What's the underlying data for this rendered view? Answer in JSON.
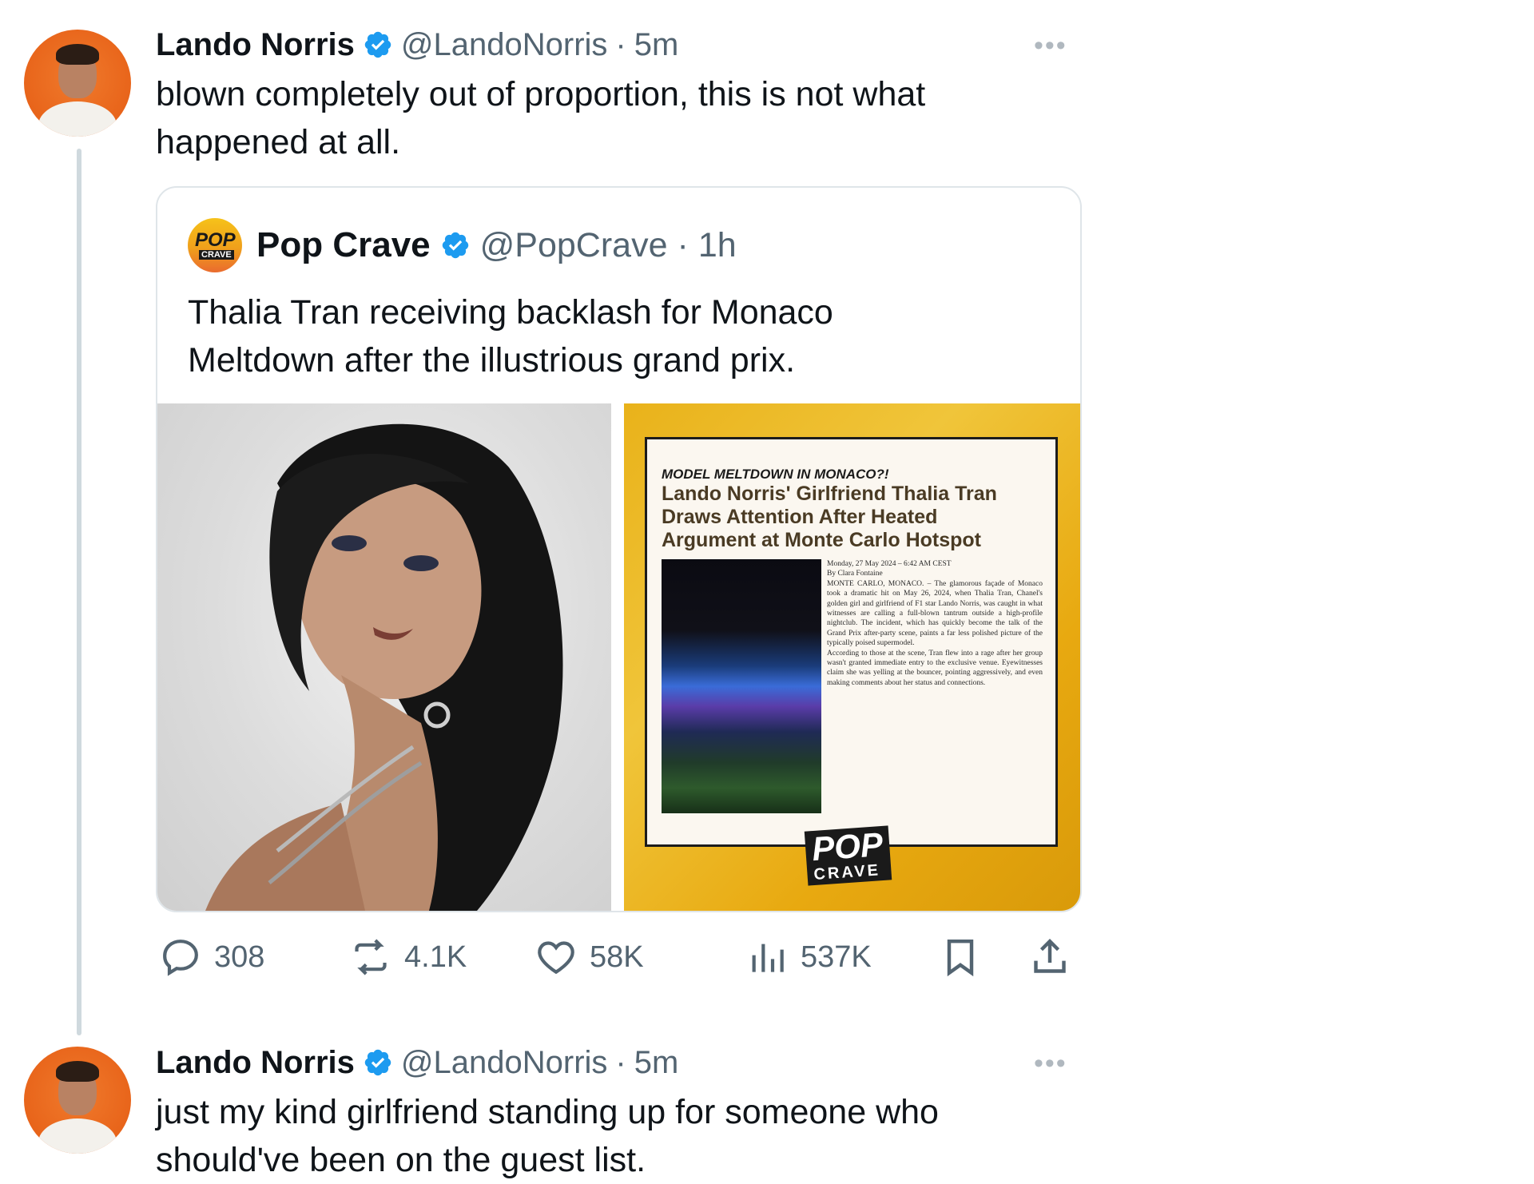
{
  "tweet1": {
    "author_name": "Lando Norris",
    "handle": "@LandoNorris",
    "separator": "·",
    "time": "5m",
    "text_line1": "blown completely out of proportion, this is not what",
    "text_line2": "happened at all.",
    "more_icon": "more-horizontal-icon"
  },
  "quote": {
    "author_name": "Pop Crave",
    "handle": "@PopCrave",
    "separator": "·",
    "time": "1h",
    "logo_top": "POP",
    "logo_bottom": "CRAVE",
    "text_line1": "Thalia Tran receiving backlash for Monaco",
    "text_line2": "Meltdown after the illustrious grand prix.",
    "article": {
      "kicker": "MODEL MELTDOWN IN MONACO?!",
      "headline_line1": "Lando Norris' Girlfriend Thalia Tran",
      "headline_line2": "Draws Attention After Heated",
      "headline_line3": "Argument at Monte Carlo Hotspot",
      "dateline": "Monday, 27 May 2024 – 6:42 AM CEST",
      "byline": "By Clara Fontaine",
      "body_p1": "MONTE CARLO, MONACO. – The glamorous façade of Monaco took a dramatic hit on May 26, 2024, when Thalia Tran, Chanel's golden girl and girlfriend of F1 star Lando Norris, was caught in what witnesses are calling a full-blown tantrum outside a high-profile nightclub. The incident, which has quickly become the talk of the Grand Prix after-party scene, paints a far less polished picture of the typically poised supermodel.",
      "body_p2": "According to those at the scene, Tran flew into a rage after her group wasn't granted immediate entry to the exclusive venue. Eyewitnesses claim she was yelling at the bouncer, pointing aggressively, and even making comments about her status and connections.",
      "badge_top": "POP",
      "badge_bottom": "CRAVE"
    }
  },
  "actions": {
    "replies": "308",
    "reposts": "4.1K",
    "likes": "58K",
    "views": "537K"
  },
  "tweet2": {
    "author_name": "Lando Norris",
    "handle": "@LandoNorris",
    "separator": "·",
    "time": "5m",
    "text_line1": "just my kind girlfriend standing up for someone who",
    "text_line2": "should've been on the guest list.",
    "more_icon": "more-horizontal-icon"
  },
  "colors": {
    "verified_blue": "#1d9bf0",
    "text_primary": "#0f1419",
    "text_secondary": "#536471",
    "avatar_orange": "#e8641a"
  }
}
